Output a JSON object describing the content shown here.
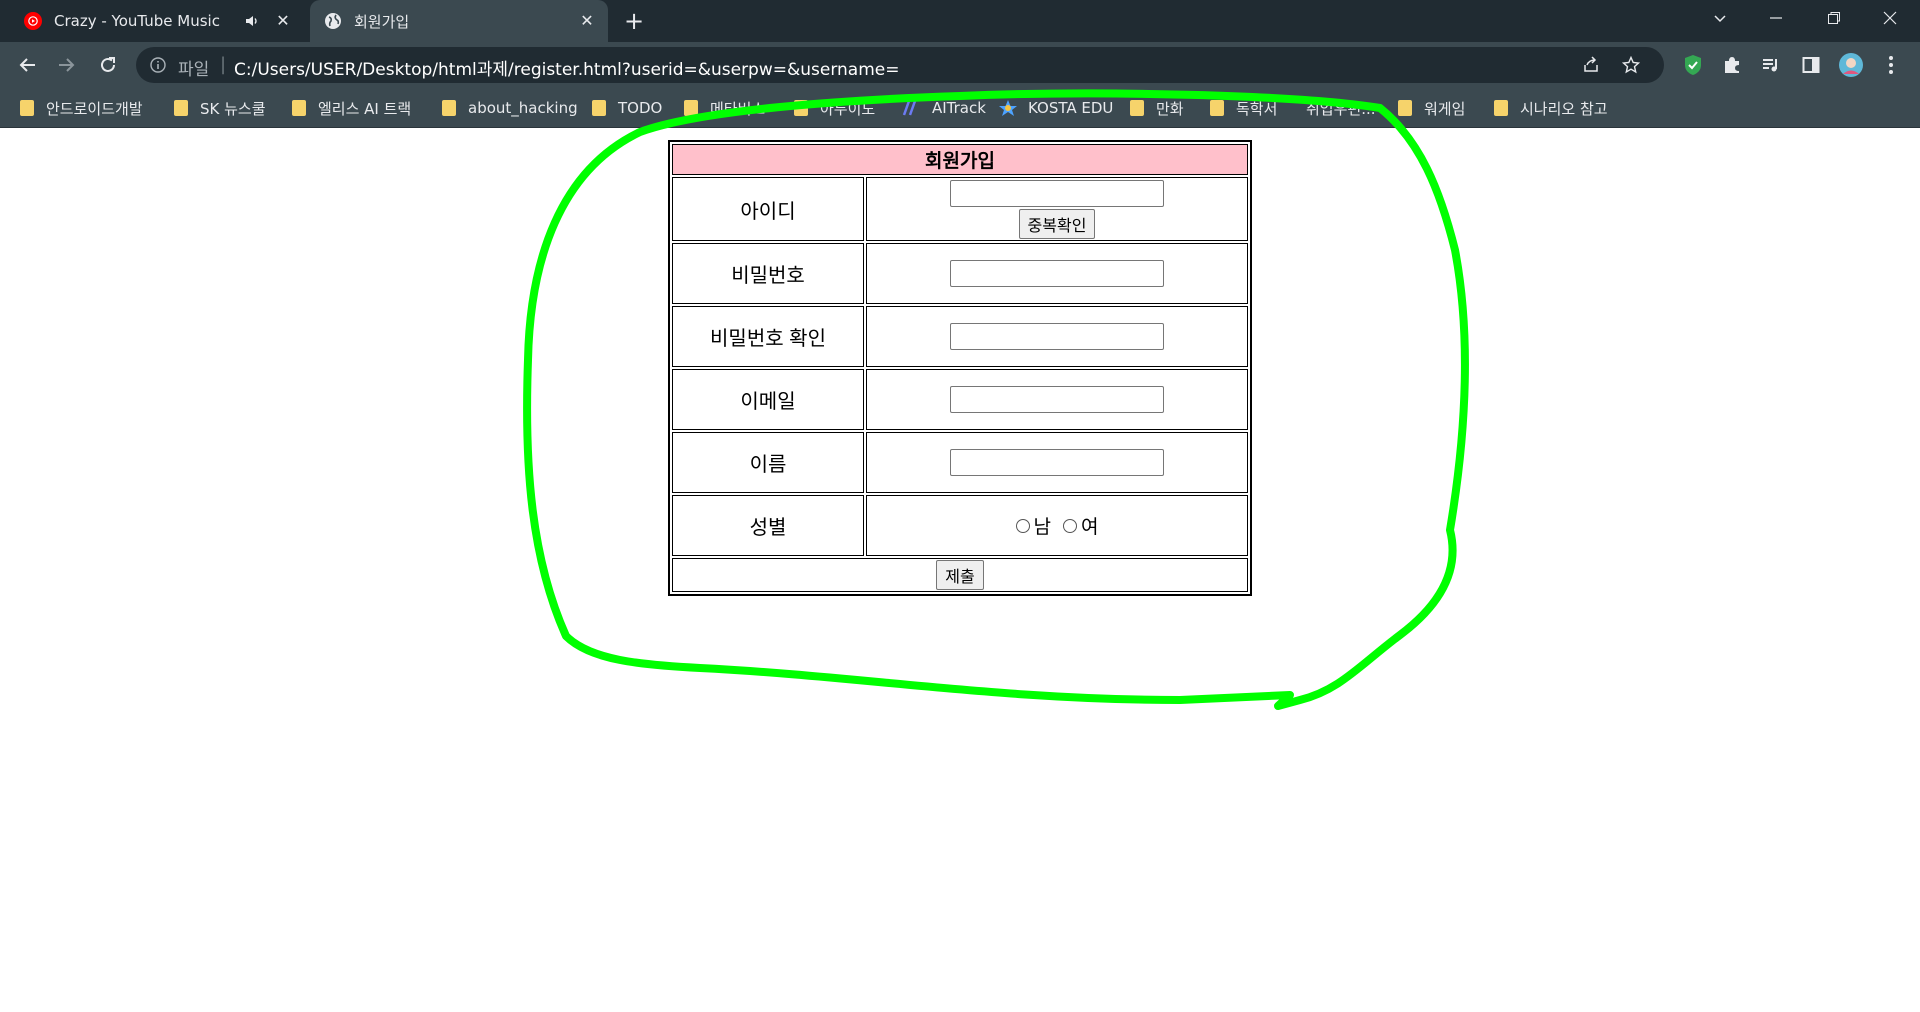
{
  "browser": {
    "tabs": [
      {
        "title": "Crazy - YouTube Music",
        "icon": "youtube-music-icon",
        "audio": true
      },
      {
        "title": "회원가입",
        "icon": "globe-icon",
        "active": true
      }
    ],
    "address": {
      "scheme_label": "파일",
      "url": "C:/Users/USER/Desktop/html과제/register.html?userid=&userpw=&username="
    },
    "bookmarks": [
      "안드로이드개발",
      "SK 뉴스쿨",
      "엘리스 AI 트랙",
      "about_hacking",
      "TODO",
      "메타버스",
      "아두이노",
      "AITrack",
      "KOSTA EDU",
      "만화",
      "독학서",
      "취업우편...",
      "워게임",
      "시나리오 참고"
    ]
  },
  "form": {
    "title": "회원가입",
    "fields": [
      {
        "label": "아이디",
        "value": ""
      },
      {
        "label": "비밀번호",
        "value": ""
      },
      {
        "label": "비밀번호 확인",
        "value": ""
      },
      {
        "label": "이메일",
        "value": ""
      },
      {
        "label": "이름",
        "value": ""
      },
      {
        "label": "성별"
      }
    ],
    "duplicate_check_label": "중복확인",
    "gender_options": [
      "남",
      "여"
    ],
    "submit_label": "제출"
  },
  "colors": {
    "header_bg": "#ffc0cb",
    "annotation": "#00ff00",
    "tabbar": "#202b32",
    "toolbar": "#3b4950"
  }
}
